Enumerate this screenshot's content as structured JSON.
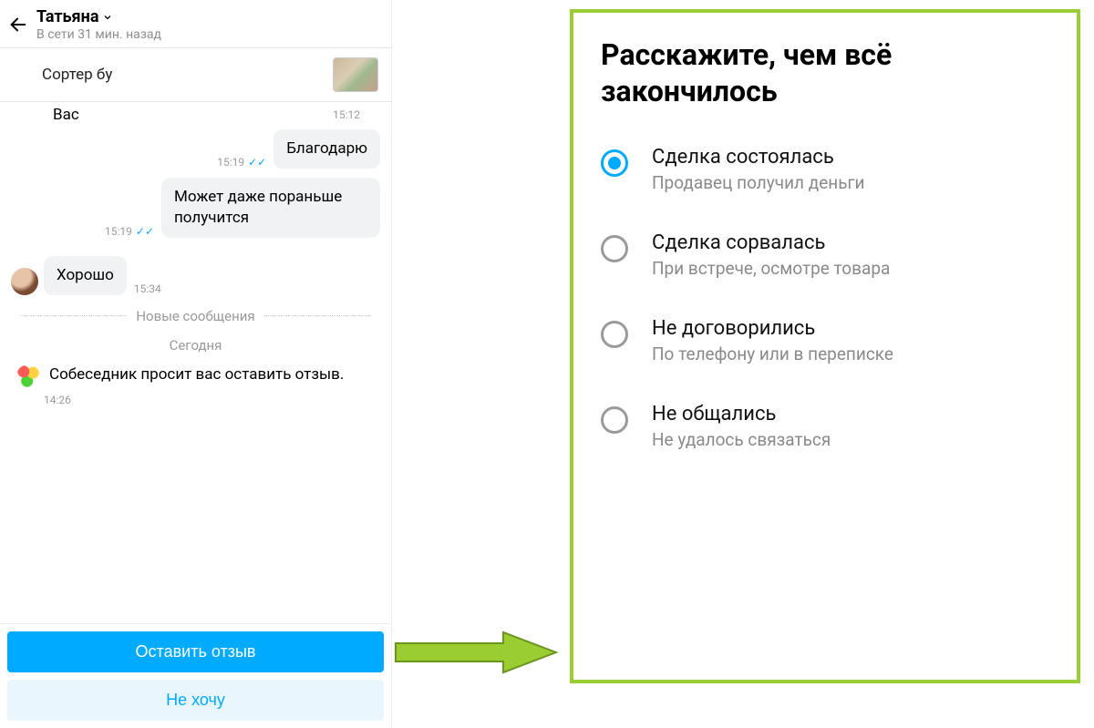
{
  "chat": {
    "contact_name": "Татьяна",
    "last_seen": "В сети 31 мин. назад",
    "listing_title": "Сортер бу",
    "partial_prev_msg": "Вас",
    "partial_prev_time": "15:12",
    "messages": [
      {
        "side": "right",
        "text": "Благодарю",
        "time": "15:19",
        "ticks": true
      },
      {
        "side": "right",
        "text": "Может даже пораньше получится",
        "time": "15:19",
        "ticks": true
      },
      {
        "side": "left",
        "text": "Хорошо",
        "time": "15:34",
        "avatar": true
      }
    ],
    "new_messages_label": "Новые сообщения",
    "today_label": "Сегодня",
    "system_prompt": "Собеседник просит вас оставить отзыв.",
    "system_time": "14:26",
    "primary_action": "Оставить отзыв",
    "secondary_action": "Не хочу"
  },
  "survey": {
    "title": "Расскажите, чем всё закончилось",
    "options": [
      {
        "title": "Сделка состоялась",
        "sub": "Продавец получил деньги",
        "selected": true
      },
      {
        "title": "Сделка сорвалась",
        "sub": "При встрече, осмотре товара",
        "selected": false
      },
      {
        "title": "Не договорились",
        "sub": "По телефону или в переписке",
        "selected": false
      },
      {
        "title": "Не общались",
        "sub": "Не удалось связаться",
        "selected": false
      }
    ]
  }
}
